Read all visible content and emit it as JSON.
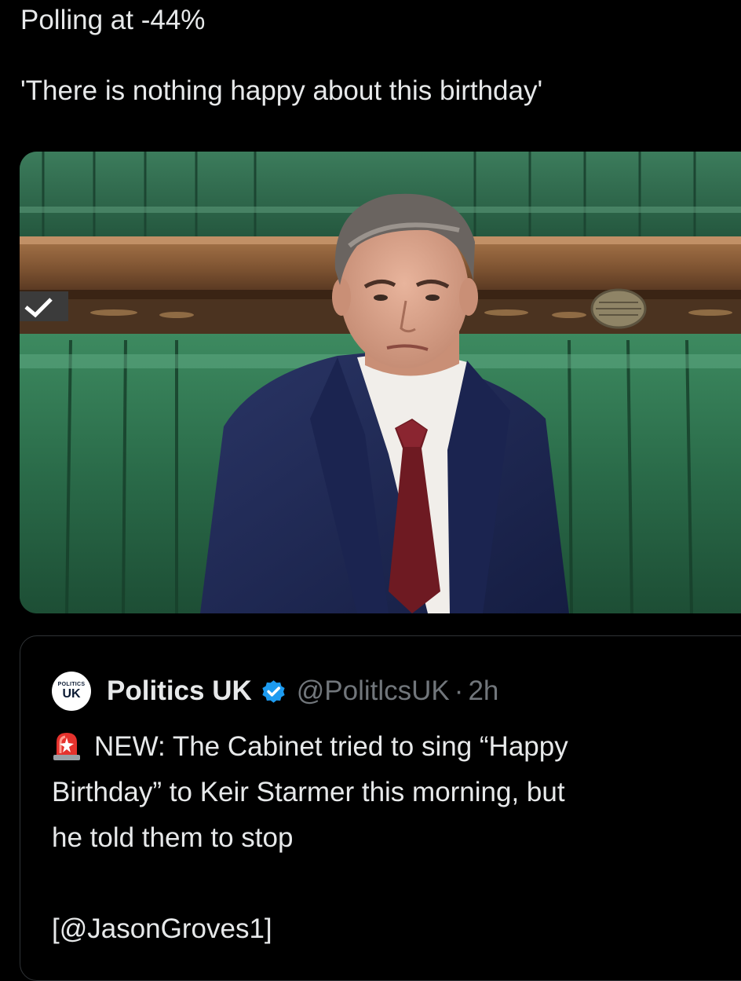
{
  "tweet": {
    "line1": "Polling at -44%",
    "line2": "'There is nothing happy about this birthday'"
  },
  "media": {
    "icon": "photo-of-man-in-parliament-bench",
    "colors": {
      "bench_green": "#2f7a52",
      "wood": "#8a5a36",
      "suit": "#1f2a55",
      "tie": "#6e1a22"
    }
  },
  "quote": {
    "avatar_text_small": "POLITICS",
    "avatar_text_big": "UK",
    "display_name": "Politics UK",
    "verified_icon": "verified-badge-icon",
    "verified_color": "#1d9bf0",
    "handle": "@PolitlcsUK",
    "separator": "·",
    "time": "2h",
    "siren_icon": "siren-emoji-icon",
    "body_line1": "NEW: The Cabinet tried to sing “Happy",
    "body_line2": "Birthday” to Keir Starmer this morning, but",
    "body_line3": "he told them to stop",
    "body_line4": "[@JasonGroves1]"
  }
}
